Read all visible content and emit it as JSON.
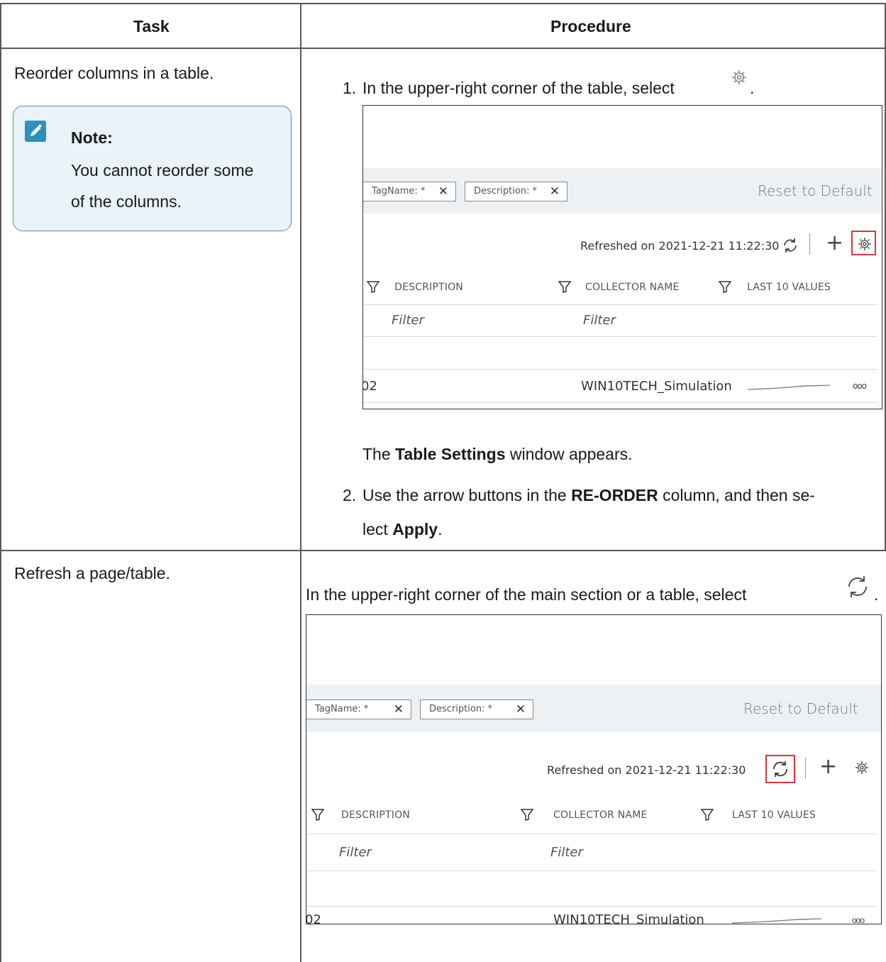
{
  "table": {
    "headers": {
      "task": "Task",
      "procedure": "Procedure"
    },
    "rows": [
      {
        "task": "Reorder columns in a table.",
        "note": {
          "title": "Note:",
          "line1": "You cannot reorder some",
          "line2": "of the columns."
        },
        "steps": {
          "step1_num": "1.",
          "step1_text": "In the upper-right corner of the table, select",
          "step1_icon": "settings-gear-icon",
          "after_shot_pre": "The ",
          "after_shot_bold": "Table Settings",
          "after_shot_post": " window appears.",
          "step2_num": "2.",
          "step2_pre": "Use the arrow buttons in the ",
          "step2_bold1": "RE-ORDER",
          "step2_mid": " column, and then se-",
          "step2_line2_pre": "lect ",
          "step2_bold2": "Apply",
          "step2_end": "."
        }
      },
      {
        "task": "Refresh a page/table.",
        "steps": {
          "text": "In the upper-right corner of the main section or a table, select",
          "icon": "refresh-icon"
        }
      }
    ]
  },
  "screenshot": {
    "chip1": "TagName: *",
    "chip2": "Description: *",
    "reset": "Reset to Default",
    "refreshed": "Refreshed on 2021-12-21 11:22:30",
    "col_description": "DESCRIPTION",
    "col_collector": "COLLECTOR NAME",
    "col_last10": "LAST 10 VALUES",
    "filter": "Filter",
    "row_id": "02",
    "row_collector": "WIN10TECH_Simulation",
    "highlight_color": "#d9363b"
  }
}
